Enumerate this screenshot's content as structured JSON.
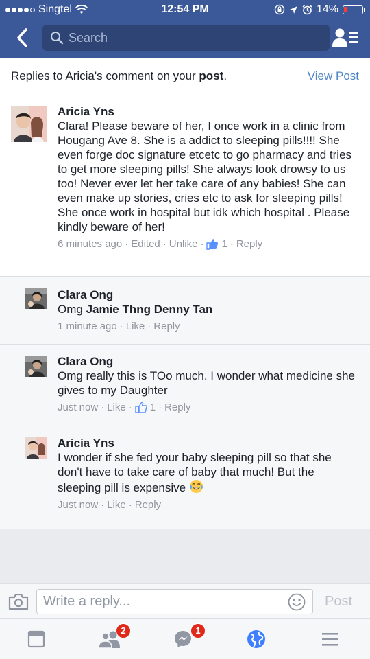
{
  "status_bar": {
    "carrier": "Singtel",
    "time": "12:54 PM",
    "battery_percent": "14%",
    "battery_level": 0.14
  },
  "nav": {
    "search_placeholder": "Search",
    "icons": [
      "back-chevron-icon",
      "search-icon",
      "friend-requests-icon"
    ]
  },
  "context": {
    "prefix": "Replies to Aricia's comment on your ",
    "post_word": "post",
    "suffix": ".",
    "view_post": "View Post"
  },
  "comments": [
    {
      "name": "Aricia Yns",
      "text": "Clara! Please beware of her, I once work in a clinic from Hougang Ave 8. She is a addict to sleeping pills!!!! She even forge doc signature etcetc to go pharmacy and tries to get more sleeping pills! She always look drowsy to us too! Never ever let her take care of any babies! She can even make up stories, cries etc to ask for sleeping pills! She once work in hospital but idk which hospital . Please kindly beware of her!",
      "time": "6 minutes ago",
      "edited": "Edited",
      "action": "Unlike",
      "likes": "1",
      "reply": "Reply"
    },
    {
      "name": "Clara Ong",
      "text_prefix": "Omg ",
      "mentions": "Jamie Thng Denny Tan",
      "time": "1 minute ago",
      "action": "Like",
      "reply": "Reply"
    },
    {
      "name": "Clara Ong",
      "text": "Omg really this is TOo much. I wonder what medicine she gives to my Daughter",
      "time": "Just now",
      "action": "Like",
      "likes": "1",
      "reply": "Reply"
    },
    {
      "name": "Aricia Yns",
      "text": "I wonder if she fed your baby sleeping pill so that she don't have to take care of baby that much! But the sleeping pill is expensive",
      "emoji": "tears-of-joy-emoji",
      "time": "Just now",
      "action": "Like",
      "reply": "Reply"
    }
  ],
  "composer": {
    "placeholder": "Write a reply...",
    "post": "Post"
  },
  "tabbar": {
    "friends_badge": "2",
    "messages_badge": "1",
    "icons": [
      "news-feed-icon",
      "friends-icon",
      "messenger-icon",
      "notifications-globe-icon",
      "menu-icon"
    ]
  },
  "colors": {
    "brand": "#3b5998",
    "link": "#4e85c7",
    "badge": "#e0291b",
    "like_blue": "#5890ff"
  }
}
